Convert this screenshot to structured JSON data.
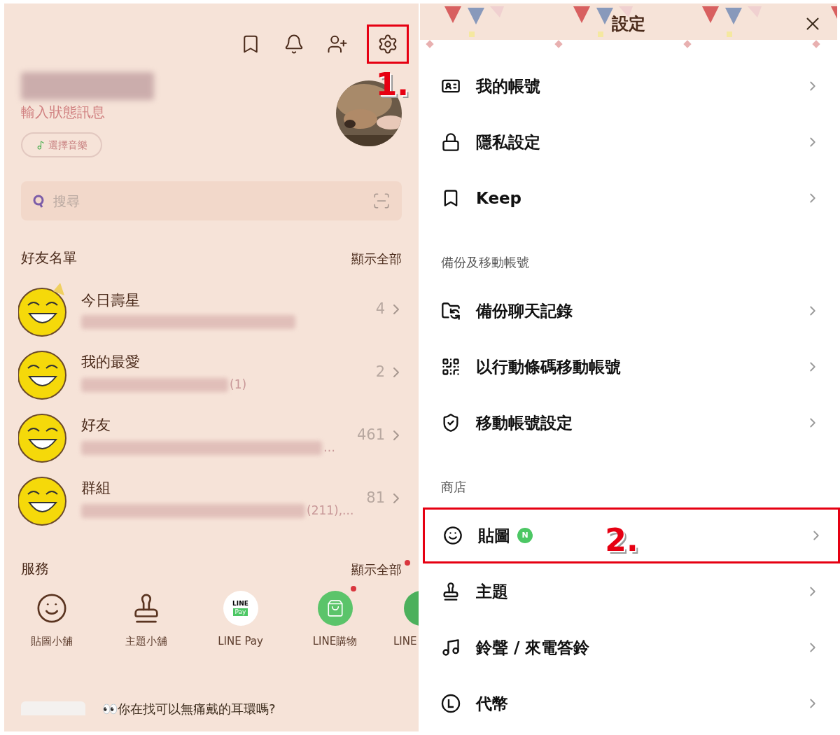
{
  "home": {
    "toolbar": [
      {
        "kind": "bookmark",
        "highlighted": false
      },
      {
        "kind": "bell",
        "highlighted": false
      },
      {
        "kind": "add-friend",
        "highlighted": false
      },
      {
        "kind": "settings",
        "highlighted": true
      }
    ],
    "profile": {
      "status_placeholder": "輸入狀態訊息",
      "music_button": "選擇音樂"
    },
    "search": {
      "placeholder": "搜尋"
    },
    "friends": {
      "title": "好友名單",
      "show_all": "顯示全部",
      "rows": [
        {
          "title": "今日壽星",
          "count": "4",
          "birthday": true
        },
        {
          "title": "我的最愛",
          "count": "2",
          "sub_tail": "(1)",
          "birthday": false
        },
        {
          "title": "好友",
          "count": "461",
          "sub_tail": "…",
          "birthday": false
        },
        {
          "title": "群組",
          "count": "81",
          "sub_tail": "(211),...",
          "birthday": false
        }
      ]
    },
    "services": {
      "title": "服務",
      "show_all": "顯示全部",
      "show_all_badge": true,
      "items": [
        {
          "kind": "sticker",
          "label": "貼圖小舖",
          "badge": false
        },
        {
          "kind": "theme",
          "label": "主題小舖",
          "badge": false
        },
        {
          "kind": "pay",
          "label": "LINE Pay",
          "badge": false,
          "logo_top": "LINE",
          "logo_bottom": "Pay"
        },
        {
          "kind": "shopping",
          "label": "LINE購物",
          "badge": true
        },
        {
          "kind": "partial",
          "label": "LINE"
        }
      ]
    },
    "feed": {
      "headline": "👀你在找可以無痛戴的耳環嗎?"
    }
  },
  "settings": {
    "title": "設定",
    "groups": [
      {
        "items": [
          {
            "kind": "id-card",
            "label": "我的帳號",
            "highlighted": false
          },
          {
            "kind": "lock",
            "label": "隱私設定",
            "highlighted": false
          },
          {
            "kind": "bookmark",
            "label": "Keep",
            "highlighted": false
          }
        ]
      },
      {
        "heading": "備份及移動帳號",
        "items": [
          {
            "kind": "folder-sync",
            "label": "備份聊天記錄",
            "highlighted": false
          },
          {
            "kind": "qr",
            "label": "以行動條碼移動帳號",
            "highlighted": false
          },
          {
            "kind": "shield",
            "label": "移動帳號設定",
            "highlighted": false
          }
        ]
      },
      {
        "heading": "商店",
        "items": [
          {
            "kind": "smile",
            "label": "貼圖",
            "badge": "N",
            "highlighted": true
          },
          {
            "kind": "stamp",
            "label": "主題",
            "highlighted": false
          },
          {
            "kind": "music",
            "label": "鈴聲 / 來電答鈴",
            "highlighted": false
          },
          {
            "kind": "coin",
            "label": "代幣",
            "highlighted": false
          }
        ]
      }
    ]
  },
  "annotations": [
    {
      "label": "1."
    },
    {
      "label": "2."
    }
  ]
}
